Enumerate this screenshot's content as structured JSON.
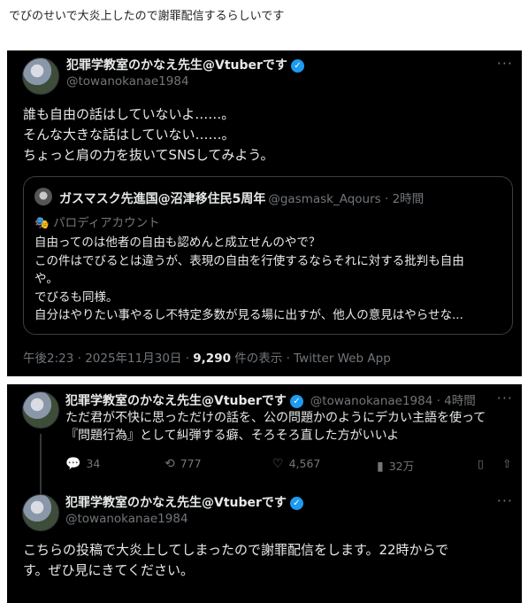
{
  "headline": "でびのせいで大炎上したので謝罪配信するらしいです",
  "tweet1": {
    "name": "犯罪学教室のかなえ先生@Vtuberです",
    "handle": "@towanokanae1984",
    "more": "···",
    "lines": [
      "誰も自由の話はしていないよ……。",
      "そんな大きな話はしていない……。",
      "ちょっと肩の力を抜いてSNSしてみよう。"
    ],
    "quote": {
      "name": "ガスマスク先進国@沼津移住民5周年",
      "handle": "@gasmask_Aqours · 2時間",
      "parody": "パロディアカウント",
      "lines": [
        "自由ってのは他者の自由も認めんと成立せんのやで？",
        "この件はでびるとは違うが、表現の自由を行使するならそれに対する批判も自由",
        "や。",
        "でびるも同様。",
        "自分はやりたい事やるし不特定多数が見る場に出すが、他人の意見はやらせな..."
      ]
    },
    "meta": {
      "time": "午後2:23 · 2025年11月30日 · ",
      "views": "9,290",
      "views_label": " 件の表示 · Twitter Web App"
    }
  },
  "tweet2": {
    "name": "犯罪学教室のかなえ先生@Vtuberです",
    "handle": "@towanokanae1984 · 4時間",
    "more": "···",
    "lines": [
      "ただ君が不快に思っただけの話を、公の問題かのようにデカい主語を使って",
      "『問題行為』として糾弾する癖、そろそろ直した方がいいよ"
    ],
    "actions": {
      "reply": "34",
      "retweet": "777",
      "like": "4,567",
      "views": "32万"
    }
  },
  "tweet3": {
    "name": "犯罪学教室のかなえ先生@Vtuberです",
    "handle": "@towanokanae1984",
    "more": "···",
    "lines": [
      "こちらの投稿で大炎上してしまったので謝罪配信をします。22時からで",
      "す。ぜひ見にきてください。"
    ]
  },
  "icons": {
    "verified": "verified-badge-icon",
    "parody": "mask-icon",
    "reply": "reply-icon",
    "retweet": "retweet-icon",
    "like": "heart-icon",
    "views": "bar-chart-icon",
    "bookmark": "bookmark-icon",
    "share": "share-icon"
  },
  "colors": {
    "background": "#000000",
    "text": "#e7e9ea",
    "muted": "#71767b",
    "accent": "#1d9bf0"
  }
}
